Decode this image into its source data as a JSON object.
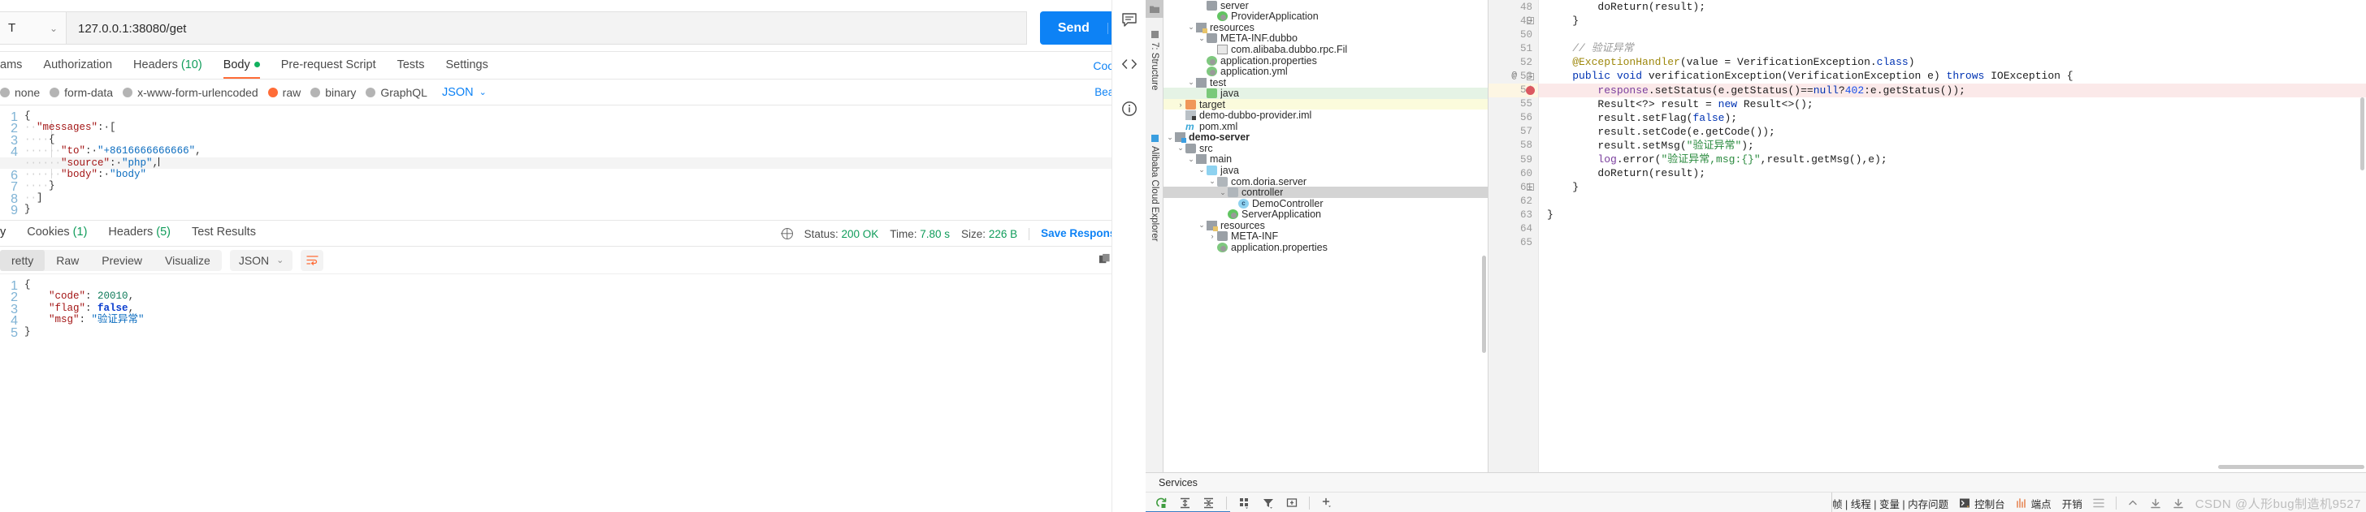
{
  "postman": {
    "request": {
      "method": "T",
      "url": "127.0.0.1:38080/get",
      "send_label": "Send",
      "send_chevron": "⌄",
      "cookies_link": "Cookies",
      "beautify_link": "Beautify"
    },
    "request_tabs": [
      {
        "label": "ams",
        "active": false
      },
      {
        "label": "Authorization",
        "active": false
      },
      {
        "label": "Headers",
        "count": "(10)",
        "active": false
      },
      {
        "label": "Body",
        "dot": true,
        "active": true
      },
      {
        "label": "Pre-request Script",
        "active": false
      },
      {
        "label": "Tests",
        "active": false
      },
      {
        "label": "Settings",
        "active": false
      }
    ],
    "body_types": [
      {
        "label": "none",
        "selected": false
      },
      {
        "label": "form-data",
        "selected": false
      },
      {
        "label": "x-www-form-urlencoded",
        "selected": false
      },
      {
        "label": "raw",
        "selected": true
      },
      {
        "label": "binary",
        "selected": false
      },
      {
        "label": "GraphQL",
        "selected": false
      }
    ],
    "body_format": {
      "value": "JSON",
      "chevron": "⌄"
    },
    "request_body_lines": [
      {
        "n": "1",
        "segments": [
          {
            "t": "{",
            "c": "p"
          }
        ]
      },
      {
        "n": "2",
        "segments": [
          {
            "t": "··",
            "c": "dots"
          },
          {
            "t": "\"messages\"",
            "c": "k"
          },
          {
            "t": ":·[",
            "c": "p"
          }
        ]
      },
      {
        "n": "3",
        "segments": [
          {
            "t": "····",
            "c": "dots"
          },
          {
            "t": "{",
            "c": "p"
          }
        ]
      },
      {
        "n": "4",
        "segments": [
          {
            "t": "······",
            "c": "dots"
          },
          {
            "t": "\"to\"",
            "c": "k"
          },
          {
            "t": ":·",
            "c": "p"
          },
          {
            "t": "\"+8616666666666\"",
            "c": "s"
          },
          {
            "t": ",",
            "c": "p"
          }
        ]
      },
      {
        "n": "5",
        "segments": [
          {
            "t": "······",
            "c": "dots"
          },
          {
            "t": "\"source\"",
            "c": "k"
          },
          {
            "t": ":·",
            "c": "p"
          },
          {
            "t": "\"php\"",
            "c": "s"
          },
          {
            "t": ",",
            "c": "p"
          }
        ],
        "highlight": true,
        "caret": true
      },
      {
        "n": "6",
        "segments": [
          {
            "t": "······",
            "c": "dots"
          },
          {
            "t": "\"body\"",
            "c": "k"
          },
          {
            "t": ":·",
            "c": "p"
          },
          {
            "t": "\"body\"",
            "c": "s"
          }
        ]
      },
      {
        "n": "7",
        "segments": [
          {
            "t": "····",
            "c": "dots"
          },
          {
            "t": "}",
            "c": "p"
          }
        ]
      },
      {
        "n": "8",
        "segments": [
          {
            "t": "··",
            "c": "dots"
          },
          {
            "t": "]",
            "c": "p"
          }
        ]
      },
      {
        "n": "9",
        "segments": [
          {
            "t": "}",
            "c": "p"
          }
        ]
      }
    ],
    "response_tabs": [
      {
        "label": "y",
        "active": true
      },
      {
        "label": "Cookies",
        "count": "(1)",
        "active": false
      },
      {
        "label": "Headers",
        "count": "(5)",
        "active": false
      },
      {
        "label": "Test Results",
        "active": false
      }
    ],
    "status": {
      "status_label": "Status:",
      "status_value": "200 OK",
      "time_label": "Time:",
      "time_value": "7.80 s",
      "size_label": "Size:",
      "size_value": "226 B",
      "save_response": "Save Response",
      "save_chevron": "⌄"
    },
    "view_modes": [
      {
        "label": "retty",
        "selected": true
      },
      {
        "label": "Raw",
        "selected": false
      },
      {
        "label": "Preview",
        "selected": false
      },
      {
        "label": "Visualize",
        "selected": false
      }
    ],
    "response_format": {
      "value": "JSON",
      "chevron": "⌄"
    },
    "response_body_lines": [
      {
        "n": "1",
        "segments": [
          {
            "t": "{",
            "c": "p"
          }
        ]
      },
      {
        "n": "2",
        "segments": [
          {
            "t": "    ",
            "c": "p"
          },
          {
            "t": "\"code\"",
            "c": "k"
          },
          {
            "t": ": ",
            "c": "p"
          },
          {
            "t": "20010",
            "c": "num"
          },
          {
            "t": ",",
            "c": "p"
          }
        ]
      },
      {
        "n": "3",
        "segments": [
          {
            "t": "    ",
            "c": "p"
          },
          {
            "t": "\"flag\"",
            "c": "k"
          },
          {
            "t": ": ",
            "c": "p"
          },
          {
            "t": "false",
            "c": "bool"
          },
          {
            "t": ",",
            "c": "p"
          }
        ]
      },
      {
        "n": "4",
        "segments": [
          {
            "t": "    ",
            "c": "p"
          },
          {
            "t": "\"msg\"",
            "c": "k"
          },
          {
            "t": ": ",
            "c": "p"
          },
          {
            "t": "\"验证异常\"",
            "c": "cn"
          }
        ]
      },
      {
        "n": "5",
        "segments": [
          {
            "t": "}",
            "c": "p"
          }
        ]
      }
    ],
    "rail_icons": [
      "comment-icon",
      "code-icon",
      "info-icon"
    ]
  },
  "ide": {
    "tool_rail": [
      {
        "label": "7: Structure",
        "icon": "structure-icon"
      },
      {
        "label": "Alibaba Cloud Explorer",
        "icon": "cloud-icon"
      }
    ],
    "project_tree": [
      {
        "label": "server",
        "indent": 3,
        "icon": "folder",
        "arrow": "",
        "state": ""
      },
      {
        "label": "ProviderApplication",
        "indent": 4,
        "icon": "spring",
        "arrow": "",
        "state": ""
      },
      {
        "label": "resources",
        "indent": 2,
        "icon": "resources",
        "arrow": "⌄",
        "state": ""
      },
      {
        "label": "META-INF.dubbo",
        "indent": 3,
        "icon": "folder",
        "arrow": "⌄",
        "state": ""
      },
      {
        "label": "com.alibaba.dubbo.rpc.Fil",
        "indent": 4,
        "icon": "file",
        "arrow": "",
        "state": ""
      },
      {
        "label": "application.properties",
        "indent": 3,
        "icon": "props",
        "arrow": "",
        "state": ""
      },
      {
        "label": "application.yml",
        "indent": 3,
        "icon": "props",
        "arrow": "",
        "state": ""
      },
      {
        "label": "test",
        "indent": 2,
        "icon": "src",
        "arrow": "⌄",
        "state": ""
      },
      {
        "label": "java",
        "indent": 3,
        "icon": "folder-green",
        "arrow": "",
        "state": "green"
      },
      {
        "label": "target",
        "indent": 1,
        "icon": "folder-orange",
        "arrow": "›",
        "state": "yellow"
      },
      {
        "label": "demo-dubbo-provider.iml",
        "indent": 1,
        "icon": "iml",
        "arrow": "",
        "state": ""
      },
      {
        "label": "pom.xml",
        "indent": 1,
        "icon": "maven",
        "arrow": "",
        "state": ""
      },
      {
        "label": "demo-server",
        "indent": 0,
        "icon": "module",
        "arrow": "⌄",
        "state": "bold"
      },
      {
        "label": "src",
        "indent": 1,
        "icon": "folder",
        "arrow": "⌄",
        "state": ""
      },
      {
        "label": "main",
        "indent": 2,
        "icon": "src",
        "arrow": "⌄",
        "state": ""
      },
      {
        "label": "java",
        "indent": 3,
        "icon": "folder-blue",
        "arrow": "⌄",
        "state": ""
      },
      {
        "label": "com.doria.server",
        "indent": 4,
        "icon": "package",
        "arrow": "⌄",
        "state": ""
      },
      {
        "label": "controller",
        "indent": 5,
        "icon": "package",
        "arrow": "⌄",
        "state": "sel"
      },
      {
        "label": "DemoController",
        "indent": 6,
        "icon": "class",
        "arrow": "",
        "state": ""
      },
      {
        "label": "ServerApplication",
        "indent": 5,
        "icon": "spring",
        "arrow": "",
        "state": ""
      },
      {
        "label": "resources",
        "indent": 3,
        "icon": "resources",
        "arrow": "⌄",
        "state": ""
      },
      {
        "label": "META-INF",
        "indent": 4,
        "icon": "folder",
        "arrow": "›",
        "state": ""
      },
      {
        "label": "application.properties",
        "indent": 4,
        "icon": "props",
        "arrow": "",
        "state": ""
      }
    ],
    "editor_lines": [
      {
        "n": "48",
        "mark": "",
        "fold": false,
        "bp": false,
        "segments": [
          {
            "t": "        doReturn(result);",
            "c": "plain"
          }
        ]
      },
      {
        "n": "49",
        "mark": "",
        "fold": true,
        "bp": false,
        "segments": [
          {
            "t": "    }",
            "c": "plain"
          }
        ]
      },
      {
        "n": "50",
        "mark": "",
        "fold": false,
        "bp": false,
        "segments": [
          {
            "t": "",
            "c": "plain"
          }
        ]
      },
      {
        "n": "51",
        "mark": "",
        "fold": false,
        "bp": false,
        "segments": [
          {
            "t": "    // 验证异常",
            "c": "cmt"
          }
        ]
      },
      {
        "n": "52",
        "mark": "",
        "fold": false,
        "bp": false,
        "segments": [
          {
            "t": "    @ExceptionHandler",
            "c": "ann"
          },
          {
            "t": "(value = VerificationException.",
            "c": "plain"
          },
          {
            "t": "class",
            "c": "kw"
          },
          {
            "t": ")",
            "c": "plain"
          }
        ]
      },
      {
        "n": "53",
        "mark": "@",
        "fold": true,
        "bp": false,
        "segments": [
          {
            "t": "    ",
            "c": "plain"
          },
          {
            "t": "public void ",
            "c": "kw"
          },
          {
            "t": "verificationException(VerificationException e) ",
            "c": "plain"
          },
          {
            "t": "throws ",
            "c": "kw"
          },
          {
            "t": "IOException {",
            "c": "plain"
          }
        ]
      },
      {
        "n": "54",
        "mark": "",
        "fold": false,
        "bp": true,
        "highlight": true,
        "segments": [
          {
            "t": "        ",
            "c": "plain"
          },
          {
            "t": "response",
            "c": "fld"
          },
          {
            "t": ".setStatus(e.getStatus()==",
            "c": "plain"
          },
          {
            "t": "null",
            "c": "kw"
          },
          {
            "t": "?",
            "c": "plain"
          },
          {
            "t": "402",
            "c": "numlit"
          },
          {
            "t": ":e.getStatus());",
            "c": "plain"
          }
        ]
      },
      {
        "n": "55",
        "mark": "",
        "fold": false,
        "bp": false,
        "segments": [
          {
            "t": "        Result<?> result = ",
            "c": "plain"
          },
          {
            "t": "new ",
            "c": "kw"
          },
          {
            "t": "Result<>();",
            "c": "plain"
          }
        ]
      },
      {
        "n": "56",
        "mark": "",
        "fold": false,
        "bp": false,
        "segments": [
          {
            "t": "        result.setFlag(",
            "c": "plain"
          },
          {
            "t": "false",
            "c": "kw"
          },
          {
            "t": ");",
            "c": "plain"
          }
        ]
      },
      {
        "n": "57",
        "mark": "",
        "fold": false,
        "bp": false,
        "segments": [
          {
            "t": "        result.setCode(e.getCode());",
            "c": "plain"
          }
        ]
      },
      {
        "n": "58",
        "mark": "",
        "fold": false,
        "bp": false,
        "segments": [
          {
            "t": "        result.setMsg(",
            "c": "plain"
          },
          {
            "t": "\"验证异常\"",
            "c": "str"
          },
          {
            "t": ");",
            "c": "plain"
          }
        ]
      },
      {
        "n": "59",
        "mark": "",
        "fold": false,
        "bp": false,
        "segments": [
          {
            "t": "        ",
            "c": "plain"
          },
          {
            "t": "log",
            "c": "fld"
          },
          {
            "t": ".error(",
            "c": "plain"
          },
          {
            "t": "\"验证异常,msg:{}\"",
            "c": "str"
          },
          {
            "t": ",result.getMsg(),e);",
            "c": "plain"
          }
        ]
      },
      {
        "n": "60",
        "mark": "",
        "fold": false,
        "bp": false,
        "segments": [
          {
            "t": "        doReturn(result);",
            "c": "plain"
          }
        ]
      },
      {
        "n": "61",
        "mark": "",
        "fold": true,
        "bp": false,
        "segments": [
          {
            "t": "    }",
            "c": "plain"
          }
        ]
      },
      {
        "n": "62",
        "mark": "",
        "fold": false,
        "bp": false,
        "segments": [
          {
            "t": "",
            "c": "plain"
          }
        ]
      },
      {
        "n": "63",
        "mark": "",
        "fold": false,
        "bp": false,
        "segments": [
          {
            "t": "}",
            "c": "plain"
          }
        ]
      },
      {
        "n": "64",
        "mark": "",
        "fold": false,
        "bp": false,
        "segments": [
          {
            "t": "",
            "c": "plain"
          }
        ]
      },
      {
        "n": "65",
        "mark": "",
        "fold": false,
        "bp": false,
        "segments": [
          {
            "t": "",
            "c": "plain"
          }
        ]
      }
    ],
    "services": {
      "title": "Services",
      "toolbar_icons": [
        "rerun-icon",
        "expand-all-icon",
        "collapse-all-icon",
        "layout-icon",
        "filter-icon",
        "group-icon",
        "add-icon"
      ],
      "right_tabs": "帧 | 线程 | 变量 | 内存问题",
      "console_label": "控制台",
      "endpoints_label": "端点",
      "overhead_label": "开销",
      "menu_icon": "hamburger-icon",
      "step_icons": [
        "step-out-icon",
        "step-over-icon",
        "step-into-icon"
      ],
      "watermark": "CSDN @人形bug制造机9527"
    }
  }
}
